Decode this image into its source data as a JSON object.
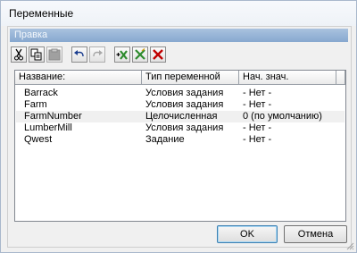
{
  "window": {
    "title": "Переменные"
  },
  "menu": {
    "items": [
      "Правка"
    ]
  },
  "toolbar": {
    "buttons": [
      {
        "icon": "cut-icon"
      },
      {
        "icon": "copy-icon"
      },
      {
        "icon": "paste-icon"
      },
      {
        "icon": "undo-icon"
      },
      {
        "icon": "redo-icon"
      },
      {
        "icon": "add-variable-icon"
      },
      {
        "icon": "edit-variable-icon"
      },
      {
        "icon": "delete-variable-icon"
      }
    ]
  },
  "table": {
    "columns": [
      "Название:",
      "Тип переменной",
      "Нач. знач."
    ],
    "rows": [
      {
        "name": "Barrack",
        "type": "Условия задания",
        "value": "- Нет -"
      },
      {
        "name": "Farm",
        "type": "Условия задания",
        "value": "- Нет -"
      },
      {
        "name": "FarmNumber",
        "type": "Целочисленная",
        "value": "0 (по умолчанию)"
      },
      {
        "name": "LumberMill",
        "type": "Условия задания",
        "value": "- Нет -"
      },
      {
        "name": "Qwest",
        "type": "Задание",
        "value": "- Нет -"
      }
    ]
  },
  "buttons": {
    "ok": "OK",
    "cancel": "Отмена"
  },
  "colors": {
    "menubar": "#87a8cf",
    "add": "#2e8b2e",
    "delete": "#c00000"
  }
}
